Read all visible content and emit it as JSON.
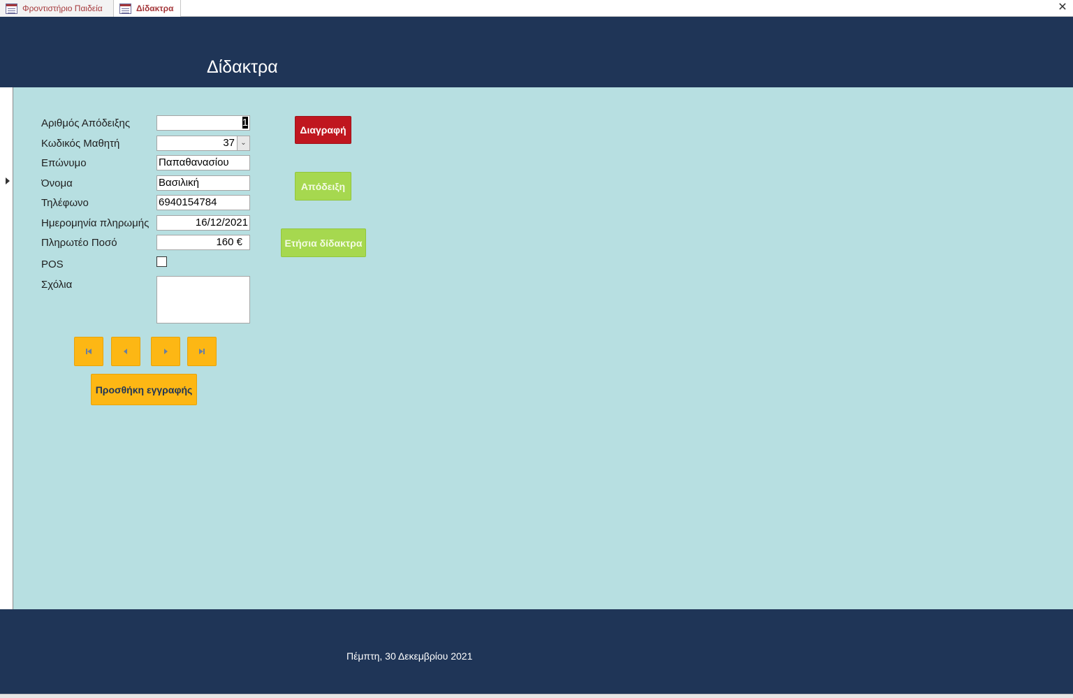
{
  "tabs": [
    {
      "label": "Φροντιστήριο Παιδεία",
      "icon": "form-icon"
    },
    {
      "label": "Δίδακτρα",
      "icon": "form-icon",
      "active": true
    }
  ],
  "header": {
    "title": "Δίδακτρα"
  },
  "form": {
    "receipt_no": {
      "label": "Αριθμός Απόδειξης",
      "value": "1"
    },
    "student_code": {
      "label": "Κωδικός Μαθητή",
      "value": "37"
    },
    "surname": {
      "label": "Επώνυμο",
      "value": "Παπαθανασίου"
    },
    "name": {
      "label": "Όνομα",
      "value": "Βασιλική"
    },
    "phone": {
      "label": "Τηλέφωνο",
      "value": "6940154784"
    },
    "payment_date": {
      "label": "Ημερομηνία πληρωμής",
      "value": "16/12/2021"
    },
    "amount": {
      "label": "Πληρωτέο Ποσό",
      "value": "160 €"
    },
    "pos": {
      "label": "POS",
      "checked": false
    },
    "comments": {
      "label": "Σχόλια",
      "value": ""
    }
  },
  "buttons": {
    "delete": "Διαγραφή",
    "receipt": "Απόδειξη",
    "annual_fees": "Ετήσια δίδακτρα",
    "add_record": "Προσθήκη εγγραφής"
  },
  "nav": [
    "first-record-icon",
    "previous-record-icon",
    "next-record-icon",
    "last-record-icon"
  ],
  "footer": {
    "date": "Πέμπτη, 30 Δεκεμβρίου 2021"
  },
  "colors": {
    "header_bg": "#1f3557",
    "body_bg": "#b7dfe1",
    "delete_btn": "#c0161f",
    "green_btn": "#a6d84f",
    "yellow_btn": "#fdb714",
    "tab_text": "#a4373a"
  }
}
